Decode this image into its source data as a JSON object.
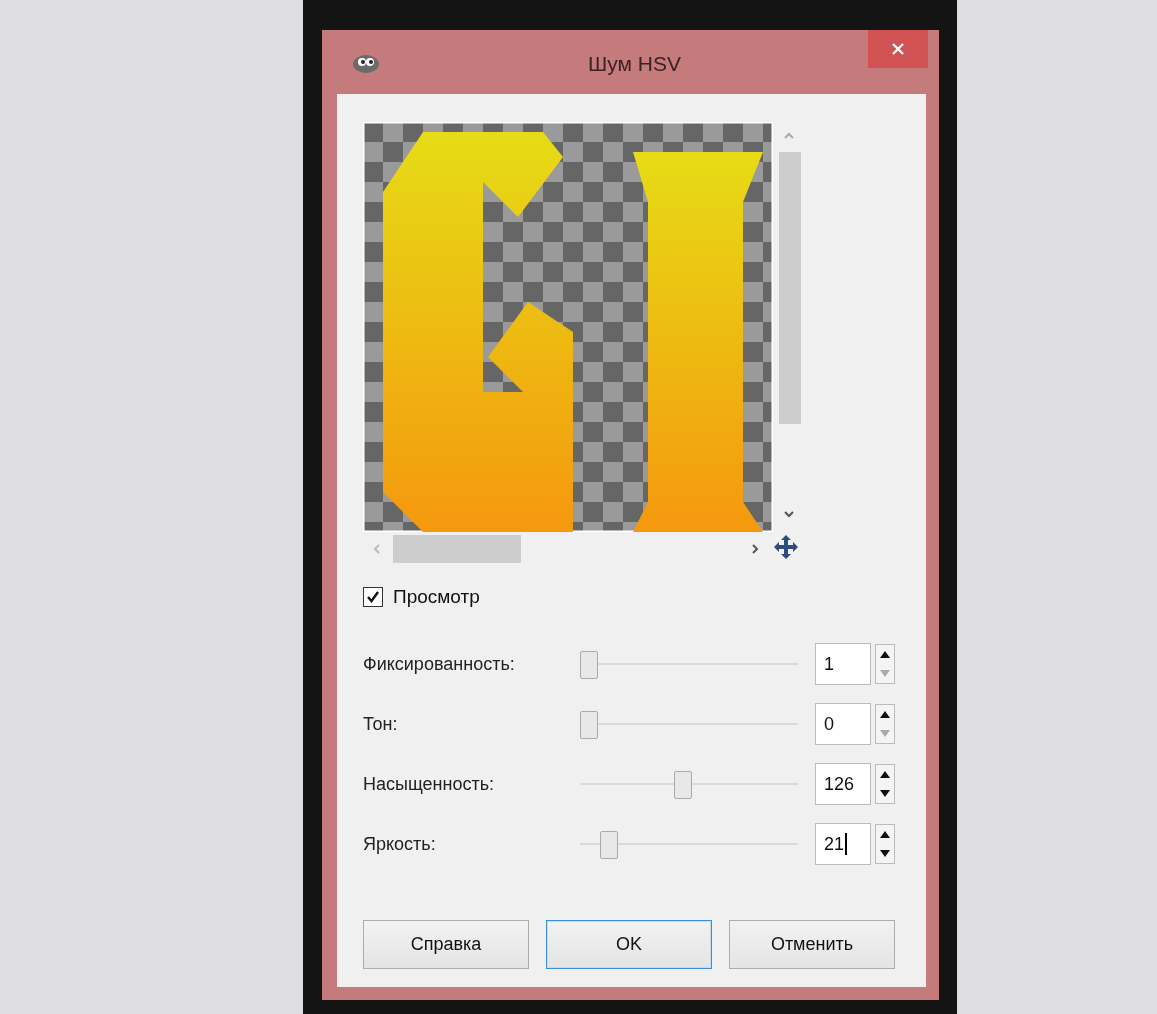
{
  "window": {
    "title": "Шум HSV"
  },
  "preview": {
    "checkbox": {
      "label": "Просмотр",
      "checked": true
    }
  },
  "sliders": [
    {
      "label": "Фиксированность:",
      "value": "1",
      "level": 0,
      "down_disabled": true,
      "focused": false
    },
    {
      "label": "Тон:",
      "value": "0",
      "level": 0,
      "down_disabled": true,
      "focused": false
    },
    {
      "label": "Насыщенность:",
      "value": "126",
      "level": 0.47,
      "down_disabled": false,
      "focused": false
    },
    {
      "label": "Яркость:",
      "value": "21",
      "level": 0.1,
      "down_disabled": false,
      "focused": true
    }
  ],
  "buttons": [
    {
      "label": "Справка",
      "default": false
    },
    {
      "label": "OK",
      "default": true
    },
    {
      "label": "Отменить",
      "default": false
    }
  ]
}
